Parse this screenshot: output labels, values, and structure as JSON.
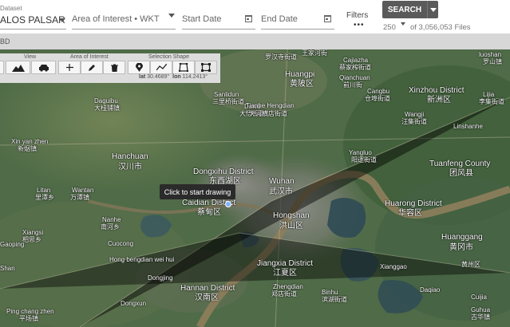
{
  "header": {
    "dataset": {
      "label": "Dataset",
      "value": "ALOS PALSAR"
    },
    "aoi": {
      "placeholder": "Area of Interest • WKT"
    },
    "start_date": {
      "placeholder": "Start Date"
    },
    "end_date": {
      "placeholder": "End Date"
    },
    "filters": {
      "label": "Filters",
      "dots": "•••"
    },
    "search": {
      "label": "SEARCH"
    },
    "results": {
      "value": "250",
      "text": "of 3,056,053 Files"
    }
  },
  "strip": {
    "text": "BD"
  },
  "toolbar": {
    "groups": {
      "view": "View",
      "aoi": "Area of Interest",
      "selection": "Selection Shape"
    },
    "coords": {
      "lat_label": "lat",
      "lat": "30.4689°",
      "lon_label": "lon",
      "lon": "114.2413°"
    }
  },
  "tooltip": "Click to start drawing",
  "map_labels": [
    {
      "t": "罗汉寺街道",
      "c": "lbl"
    },
    {
      "t": "王家河街",
      "c": "lbl"
    },
    {
      "t": "luoshan",
      "c": "lbl"
    },
    {
      "t": "罗山镇",
      "c": "lbl"
    },
    {
      "t": "Cajiazha",
      "c": "lbl"
    },
    {
      "t": "蔡家榨街道",
      "c": "lbl"
    },
    {
      "t": "Huangpi",
      "c": "lbl big"
    },
    {
      "t": "黄陂区",
      "c": "lbl big"
    },
    {
      "t": "Qianchuan",
      "c": "lbl"
    },
    {
      "t": "前川街",
      "c": "lbl"
    },
    {
      "t": "Sanlidun",
      "c": "lbl"
    },
    {
      "t": "三里桥街道",
      "c": "lbl"
    },
    {
      "t": "Xinzhou District",
      "c": "lbl big"
    },
    {
      "t": "新洲区",
      "c": "lbl big"
    },
    {
      "t": "Lijia",
      "c": "lbl"
    },
    {
      "t": "李集街道",
      "c": "lbl"
    },
    {
      "t": "Dawu",
      "c": "lbl"
    },
    {
      "t": "大悟街道",
      "c": "lbl"
    },
    {
      "t": "Tianhe Hengdian",
      "c": "lbl"
    },
    {
      "t": "天河横店街道",
      "c": "lbl"
    },
    {
      "t": "Cangbu",
      "c": "lbl"
    },
    {
      "t": "仓埠街道",
      "c": "lbl"
    },
    {
      "t": "Wangji",
      "c": "lbl"
    },
    {
      "t": "汪集街道",
      "c": "lbl"
    },
    {
      "t": "Linshanhe",
      "c": "lbl"
    },
    {
      "t": "Daguibu",
      "c": "lbl"
    },
    {
      "t": "大桂铺镇",
      "c": "lbl"
    },
    {
      "t": "Xin yan zhen",
      "c": "lbl"
    },
    {
      "t": "新烟镇",
      "c": "lbl"
    },
    {
      "t": "Hanchuan",
      "c": "lbl big"
    },
    {
      "t": "汉川市",
      "c": "lbl big"
    },
    {
      "t": "Yangluo",
      "c": "lbl"
    },
    {
      "t": "阳逻街道",
      "c": "lbl"
    },
    {
      "t": "Tuanfeng County",
      "c": "lbl big"
    },
    {
      "t": "团风县",
      "c": "lbl big"
    },
    {
      "t": "Dongxihu District",
      "c": "lbl big"
    },
    {
      "t": "东西湖区",
      "c": "lbl big"
    },
    {
      "t": "Wuhan",
      "c": "lbl big"
    },
    {
      "t": "武汉市",
      "c": "lbl big"
    },
    {
      "t": "Caidian District",
      "c": "lbl big"
    },
    {
      "t": "蔡甸区",
      "c": "lbl big"
    },
    {
      "t": "Hongshan",
      "c": "lbl big"
    },
    {
      "t": "洪山区",
      "c": "lbl big"
    },
    {
      "t": "Huarong District",
      "c": "lbl big"
    },
    {
      "t": "华容区",
      "c": "lbl big"
    },
    {
      "t": "Litan",
      "c": "lbl"
    },
    {
      "t": "里潭乡",
      "c": "lbl"
    },
    {
      "t": "Wantan",
      "c": "lbl"
    },
    {
      "t": "万潭镇",
      "c": "lbl"
    },
    {
      "t": "Nanhe",
      "c": "lbl"
    },
    {
      "t": "南河乡",
      "c": "lbl"
    },
    {
      "t": "Xiangsi",
      "c": "lbl"
    },
    {
      "t": "相思乡",
      "c": "lbl"
    },
    {
      "t": "Cuocong",
      "c": "lbl"
    },
    {
      "t": "Huanggang",
      "c": "lbl big"
    },
    {
      "t": "黄冈市",
      "c": "lbl big"
    },
    {
      "t": "Jiangxia District",
      "c": "lbl big"
    },
    {
      "t": "江夏区",
      "c": "lbl big"
    },
    {
      "t": "Hannan District",
      "c": "lbl big"
    },
    {
      "t": "汉南区",
      "c": "lbl big"
    },
    {
      "t": "Shan",
      "c": "lbl"
    },
    {
      "t": "Ping chang zhen",
      "c": "lbl"
    },
    {
      "t": "平场镇",
      "c": "lbl"
    },
    {
      "t": "Dongxun",
      "c": "lbl"
    },
    {
      "t": "Binhu",
      "c": "lbl"
    },
    {
      "t": "滨湖街道",
      "c": "lbl"
    },
    {
      "t": "Hong bengdian wei hui",
      "c": "lbl"
    },
    {
      "t": "Zhengdian",
      "c": "lbl"
    },
    {
      "t": "郑店街道",
      "c": "lbl"
    },
    {
      "t": "Dongjing",
      "c": "lbl"
    },
    {
      "t": "Gaoping",
      "c": "lbl"
    },
    {
      "t": "Xianggao",
      "c": "lbl"
    },
    {
      "t": "Daqiao",
      "c": "lbl"
    },
    {
      "t": "Cuijia",
      "c": "lbl"
    },
    {
      "t": "黄州区",
      "c": "lbl"
    },
    {
      "t": "Guhua",
      "c": "lbl"
    },
    {
      "t": "古华镇",
      "c": "lbl"
    }
  ]
}
